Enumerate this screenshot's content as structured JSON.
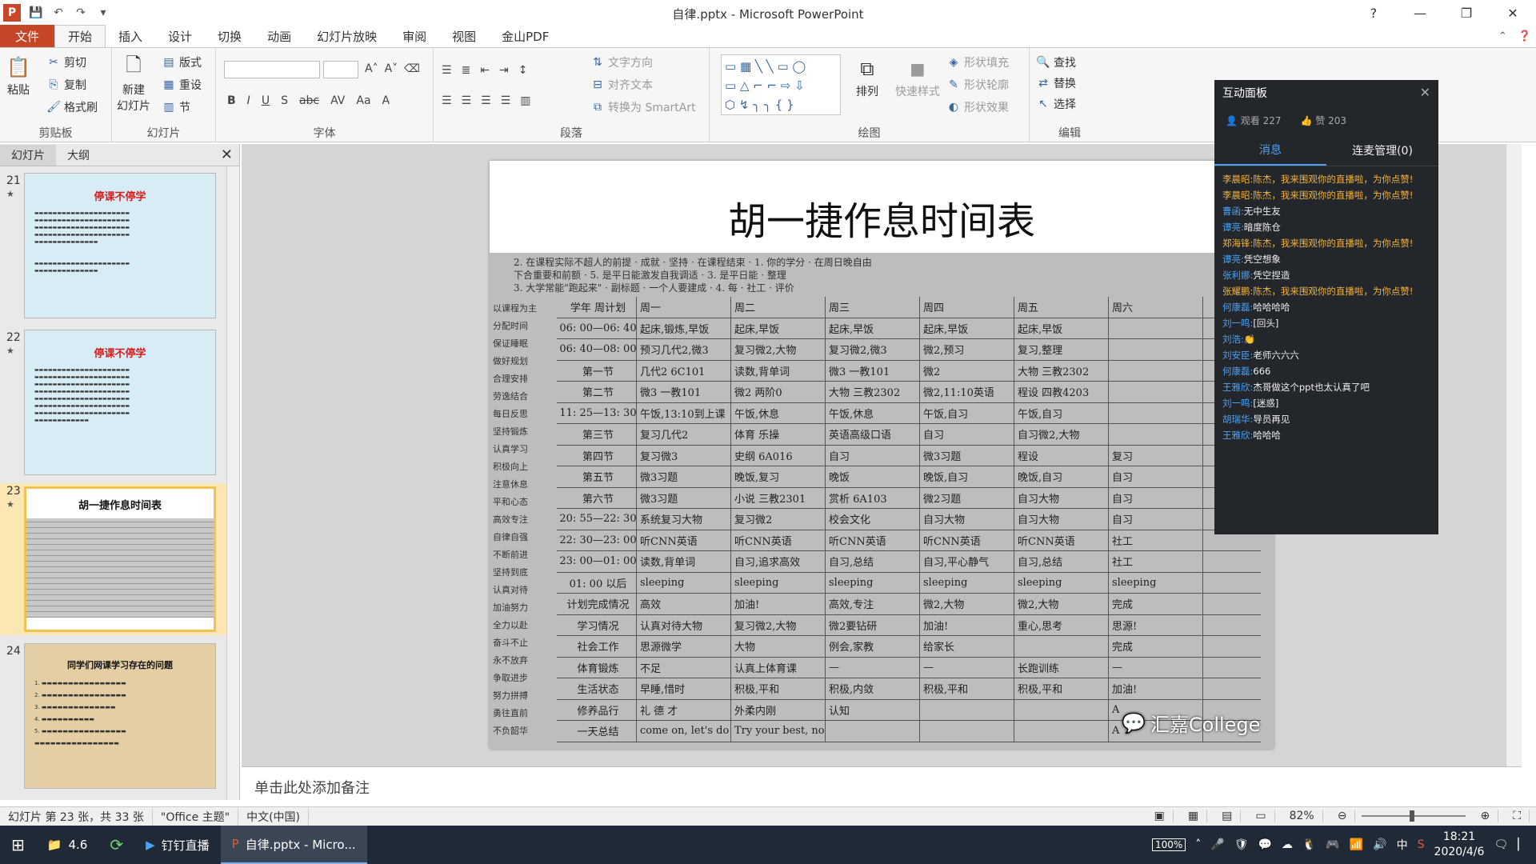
{
  "window": {
    "title": "自律.pptx - Microsoft PowerPoint"
  },
  "menu": {
    "file": "文件",
    "tabs": [
      "开始",
      "插入",
      "设计",
      "切换",
      "动画",
      "幻灯片放映",
      "审阅",
      "视图",
      "金山PDF"
    ],
    "active": "开始"
  },
  "ribbon": {
    "clipboard": {
      "label": "剪贴板",
      "paste": "粘贴",
      "cut": "剪切",
      "copy": "复制",
      "format_painter": "格式刷"
    },
    "slides": {
      "label": "幻灯片",
      "new_slide": "新建\n幻灯片",
      "layout": "版式",
      "reset": "重设",
      "section": "节"
    },
    "font": {
      "label": "字体"
    },
    "paragraph": {
      "label": "段落",
      "text_direction": "文字方向",
      "align_text": "对齐文本",
      "smartart": "转换为 SmartArt"
    },
    "drawing": {
      "label": "绘图",
      "arrange": "排列",
      "quick_styles": "快速样式",
      "shape_fill": "形状填充",
      "shape_outline": "形状轮廓",
      "shape_effects": "形状效果"
    },
    "editing": {
      "label": "编辑",
      "find": "查找",
      "replace": "替换",
      "select": "选择"
    }
  },
  "left_pane": {
    "tabs": [
      "幻灯片",
      "大纲"
    ],
    "slides": [
      {
        "num": "21",
        "title": "停课不停学",
        "theme": "#d7ecf5"
      },
      {
        "num": "22",
        "title": "停课不停学",
        "theme": "#d7ecf5"
      },
      {
        "num": "23",
        "title": "胡一捷作息时间表",
        "theme": "#ffffff",
        "selected": true
      },
      {
        "num": "24",
        "title": "同学们网课学习存在的问题",
        "theme": "#e4cfa4"
      }
    ]
  },
  "slide": {
    "title": "胡一捷作息时间表",
    "watermark": "汇嘉College",
    "table_header": [
      "学年 周计划",
      "周一",
      "周二",
      "周三",
      "周四",
      "周五",
      "周六"
    ],
    "table_rows": [
      [
        "06: 00—06: 40",
        "起床,锻炼,早饭",
        "起床,早饭",
        "起床,早饭",
        "起床,早饭",
        "起床,早饭",
        ""
      ],
      [
        "06: 40—08: 00",
        "预习几代2,微3",
        "复习微2,大物",
        "复习微2,微3",
        "微2,预习",
        "复习,整理",
        ""
      ],
      [
        "第一节",
        "几代2 6C101",
        "读数,背单词",
        "微3 一教101",
        "微2",
        "大物 三教2302",
        ""
      ],
      [
        "第二节",
        "微3 一教101",
        "微2 两阶0",
        "大物 三教2302",
        "微2,11:10英语",
        "程设 四教4203",
        ""
      ],
      [
        "11: 25—13: 30",
        "午饭,13:10到上课",
        "午饭,休息",
        "午饭,休息",
        "午饭,自习",
        "午饭,自习",
        ""
      ],
      [
        "第三节",
        "复习几代2",
        "体育 乐操",
        "英语高级口语",
        "自习",
        "自习微2,大物",
        ""
      ],
      [
        "第四节",
        "复习微3",
        "史纲 6A016",
        "自习",
        "微3习题",
        "程设",
        "复习"
      ],
      [
        "第五节",
        "微3习题",
        "晚饭,复习",
        "晚饭",
        "晚饭,自习",
        "晚饭,自习",
        "自习"
      ],
      [
        "第六节",
        "微3习题",
        "小说 三教2301",
        "赏析 6A103",
        "微2习题",
        "自习大物",
        "自习"
      ],
      [
        "20: 55—22: 30",
        "系统复习大物",
        "复习微2",
        "校会文化",
        "自习大物",
        "自习大物",
        "自习"
      ],
      [
        "22: 30—23: 00",
        "听CNN英语",
        "听CNN英语",
        "听CNN英语",
        "听CNN英语",
        "听CNN英语",
        "社工"
      ],
      [
        "23: 00—01: 00",
        "读数,背单词",
        "自习,追求高效",
        "自习,总结",
        "自习,平心静气",
        "自习,总结",
        "社工"
      ],
      [
        "01: 00 以后",
        "sleeping",
        "sleeping",
        "sleeping",
        "sleeping",
        "sleeping",
        "sleeping"
      ],
      [
        "计划完成情况",
        "高效",
        "加油!",
        "高效,专注",
        "微2,大物",
        "微2,大物",
        "完成"
      ],
      [
        "学习情况",
        "认真对待大物",
        "复习微2,大物",
        "微2要钻研",
        "加油!",
        "重心,思考",
        "思源!"
      ],
      [
        "社会工作",
        "思源微学",
        "大物",
        "例会,家教",
        "给家长",
        "",
        "完成"
      ],
      [
        "体育锻炼",
        "不足",
        "认真上体育课",
        "—",
        "—",
        "长跑训练",
        "—"
      ],
      [
        "生活状态",
        "早睡,惜时",
        "积极,平和",
        "积极,内敛",
        "积极,平和",
        "积极,平和",
        "加油!"
      ],
      [
        "修养品行",
        "礼 德 才",
        "外柔内刚",
        "认知",
        "",
        "",
        "A"
      ],
      [
        "一天总结",
        "come on, let's do our best!",
        "Try your best, no matter what",
        "",
        "",
        "",
        "A"
      ]
    ]
  },
  "notes": {
    "placeholder": "单击此处添加备注"
  },
  "status": {
    "slide": "幻灯片 第 23 张，共 33 张",
    "theme": "\"Office 主题\"",
    "lang": "中文(中国)",
    "zoom": "82%"
  },
  "panel": {
    "title": "互动面板",
    "viewers": "观看 227",
    "likes": "赞 203",
    "tabs": [
      "消息",
      "连麦管理(0)"
    ],
    "messages": [
      {
        "name": "李晨昭:",
        "text": "陈杰，我来围观你的直播啦，为你点赞!",
        "hi": true
      },
      {
        "name": "李晨昭:",
        "text": "陈杰，我来围观你的直播啦，为你点赞!",
        "hi": true
      },
      {
        "name": "曹函:",
        "text": "无中生友",
        "hi": false
      },
      {
        "name": "谭亮:",
        "text": "暗度陈仓",
        "hi": false
      },
      {
        "name": "郑海锋:",
        "text": "陈杰，我来围观你的直播啦，为你点赞!",
        "hi": true
      },
      {
        "name": "谭亮:",
        "text": "凭空想象",
        "hi": false
      },
      {
        "name": "张利娜:",
        "text": "凭空捏造",
        "hi": false
      },
      {
        "name": "张耀鹏:",
        "text": "陈杰，我来围观你的直播啦，为你点赞!",
        "hi": true
      },
      {
        "name": "何康磊:",
        "text": "哈哈哈哈",
        "hi": false
      },
      {
        "name": "刘一鸣:",
        "text": "[回头]",
        "hi": false
      },
      {
        "name": "刘浩:",
        "text": "👏",
        "hi": false
      },
      {
        "name": "刘安臣:",
        "text": "老师六六六",
        "hi": false
      },
      {
        "name": "何康磊:",
        "text": "666",
        "hi": false
      },
      {
        "name": "王雅欣:",
        "text": "杰哥做这个ppt也太认真了吧",
        "hi": false
      },
      {
        "name": "刘一鸣:",
        "text": "[迷惑]",
        "hi": false
      },
      {
        "name": "胡瑞华:",
        "text": "导员再见",
        "hi": false
      },
      {
        "name": "王雅欣:",
        "text": "哈哈哈",
        "hi": false
      }
    ]
  },
  "taskbar": {
    "items": [
      "4.6",
      "",
      "钉钉直播",
      "自律.pptx - Micro..."
    ],
    "battery": "100%",
    "ime": "中",
    "time": "18:21",
    "date": "2020/4/6"
  }
}
